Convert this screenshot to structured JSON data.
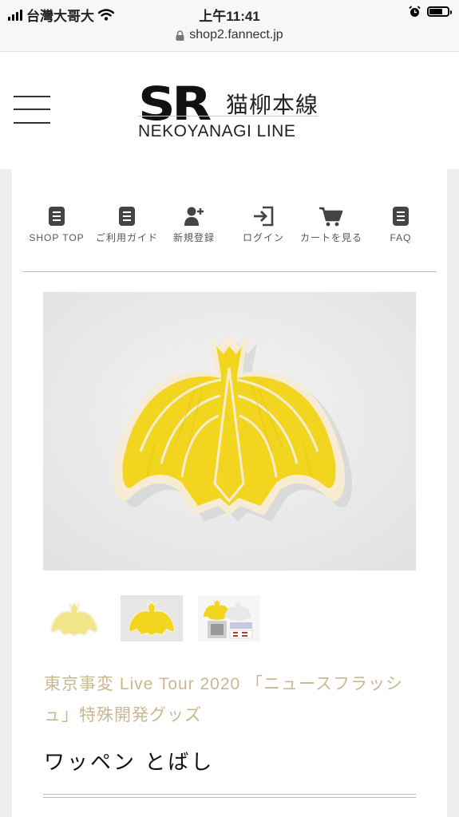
{
  "status_bar": {
    "carrier": "台灣大哥大",
    "time": "上午11:41",
    "battery_level": 0.68
  },
  "browser": {
    "url": "shop2.fannect.jp"
  },
  "logo": {
    "mark": "SR",
    "japanese": "猫柳本線",
    "english": "NEKOYANAGI LINE"
  },
  "nav": [
    {
      "label": "SHOP TOP",
      "icon": "document-icon"
    },
    {
      "label": "ご利用ガイド",
      "icon": "document-icon"
    },
    {
      "label": "新規登録",
      "icon": "add-user-icon"
    },
    {
      "label": "ログイン",
      "icon": "login-icon"
    },
    {
      "label": "カートを見る",
      "icon": "cart-icon"
    },
    {
      "label": "FAQ",
      "icon": "document-icon"
    }
  ],
  "product": {
    "subtitle": "東京事変 Live Tour 2020 「ニュースフラッシュ」特殊開発グッズ",
    "title": "ワッペン とばし",
    "thumbnails": [
      "thumbnail-1",
      "thumbnail-2",
      "thumbnail-3"
    ]
  },
  "colors": {
    "accent_text": "#c9b98f",
    "patch_yellow": "#f2d51e",
    "patch_border": "#f7ecd3"
  }
}
